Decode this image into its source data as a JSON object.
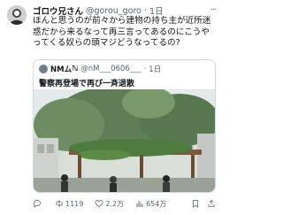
{
  "tweet": {
    "name": "ゴロウ兄さん",
    "handle": "@gorou_goro",
    "time": "1日",
    "more": "...",
    "text": "ほんと思うのが前々から建物の持ち主が近所迷惑だから来るなって再三言ってあるのにこうやってくる奴らの頭マジどうなってるの?"
  },
  "quote": {
    "name": "NMム",
    "badge": "ℕ",
    "handle": "@nM___0606___",
    "time": "1日",
    "text": "警察再登場で再び一斉退散"
  },
  "actions": {
    "replies": "",
    "reposts": "1119",
    "likes": "2.2万",
    "views": "654万"
  },
  "icons": [
    "reply-icon",
    "repost-icon",
    "like-icon",
    "views-icon",
    "bookmark-icon",
    "share-icon"
  ]
}
